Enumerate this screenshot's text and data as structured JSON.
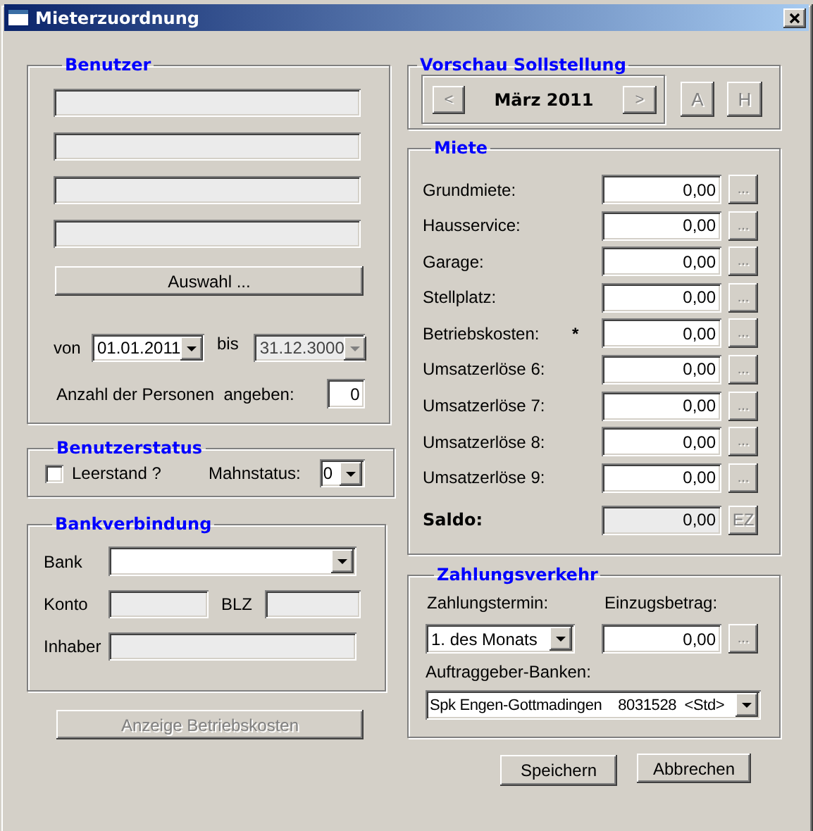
{
  "window": {
    "title": "Mieterzuordnung"
  },
  "benutzer": {
    "title": "Benutzer",
    "fields": [
      {
        "disabled": true
      },
      {
        "disabled": true
      },
      {
        "disabled": true
      },
      {
        "disabled": true
      }
    ],
    "select_button": {
      "label": "Auswahl ...",
      "disabled": false
    },
    "von": {
      "label": "von",
      "value": "01.01.2011",
      "disabled": false
    },
    "bis": {
      "label": "bis",
      "value": "31.12.3000",
      "disabled": true
    },
    "persons": {
      "label": "Anzahl der Personen  angeben:",
      "value": "0"
    }
  },
  "status": {
    "title": "Benutzerstatus",
    "leerstand": {
      "label": "Leerstand ?",
      "checked": false
    },
    "mahnstatus": {
      "label": "Mahnstatus:",
      "value": "0"
    }
  },
  "bank": {
    "title": "Bankverbindung",
    "bank_label": "Bank",
    "konto_label": "Konto",
    "blz_label": "BLZ",
    "inhaber_label": "Inhaber"
  },
  "betriebskosten_button": {
    "label": "Anzeige Betriebskosten",
    "disabled": true
  },
  "preview": {
    "title": "Vorschau Sollstellung",
    "prev": {
      "label": "<",
      "disabled": true
    },
    "month": "März 2011",
    "next": {
      "label": ">",
      "disabled": true
    },
    "buttons": [
      {
        "label": "A",
        "disabled": true
      },
      {
        "label": "H",
        "disabled": true
      }
    ]
  },
  "miete": {
    "title": "Miete",
    "rows": [
      {
        "label": "Grundmiete:",
        "value": "0,00",
        "button": {
          "label": "...",
          "disabled": true
        }
      },
      {
        "label": "Hausservice:",
        "value": "0,00",
        "button": {
          "label": "...",
          "disabled": true
        }
      },
      {
        "label": "Garage:",
        "value": "0,00",
        "button": {
          "label": "...",
          "disabled": true
        }
      },
      {
        "label": "Stellplatz:",
        "value": "0,00",
        "button": {
          "label": "...",
          "disabled": true
        }
      },
      {
        "label": "Betriebskosten:",
        "marker": "*",
        "value": "0,00",
        "button": {
          "label": "...",
          "disabled": true
        }
      },
      {
        "label": "Umsatzerlöse 6:",
        "value": "0,00",
        "button": {
          "label": "...",
          "disabled": true
        }
      },
      {
        "label": "Umsatzerlöse 7:",
        "value": "0,00",
        "button": {
          "label": "...",
          "disabled": true
        }
      },
      {
        "label": "Umsatzerlöse 8:",
        "value": "0,00",
        "button": {
          "label": "...",
          "disabled": true
        }
      },
      {
        "label": "Umsatzerlöse 9:",
        "value": "0,00",
        "button": {
          "label": "...",
          "disabled": true
        }
      }
    ],
    "saldo": {
      "label": "Saldo:",
      "value": "0,00",
      "button": {
        "label": "EZ",
        "disabled": true
      }
    }
  },
  "zahlung": {
    "title": "Zahlungsverkehr",
    "termin_label": "Zahlungstermin:",
    "termin_value": "1. des Monats",
    "betrag_label": "Einzugsbetrag:",
    "betrag_value": "0,00",
    "betrag_button": {
      "label": "...",
      "disabled": true
    },
    "banken_label": "Auftraggeber-Banken:",
    "banken_value": "Spk Engen-Gottmadingen    8031528  <Std>"
  },
  "buttons": [
    {
      "label": "Speichern"
    },
    {
      "label": "Abbrechen"
    }
  ]
}
